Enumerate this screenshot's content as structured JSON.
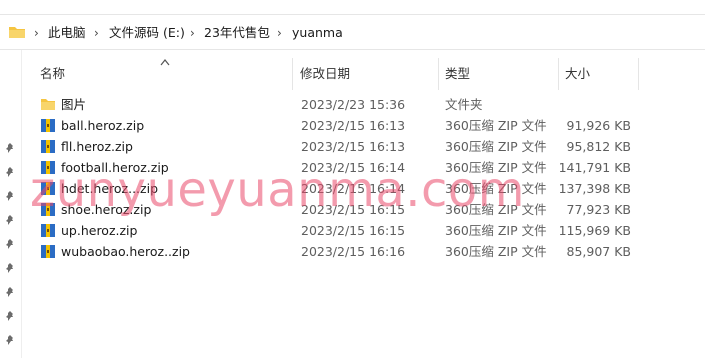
{
  "breadcrumb": {
    "items": [
      "此电脑",
      "文件源码 (E:)",
      "23年代售包",
      "yuanma"
    ],
    "separator": "›"
  },
  "header": {
    "name": "名称",
    "modified": "修改日期",
    "type": "类型",
    "size": "大小"
  },
  "files": [
    {
      "name": "图片",
      "modified": "2023/2/23 15:36",
      "type": "文件夹",
      "size": "",
      "icon": "folder-icon"
    },
    {
      "name": "ball.heroz.zip",
      "modified": "2023/2/15 16:13",
      "type": "360压缩 ZIP 文件",
      "size": "91,926 KB",
      "icon": "zip-archive-icon"
    },
    {
      "name": "fll.heroz.zip",
      "modified": "2023/2/15 16:13",
      "type": "360压缩 ZIP 文件",
      "size": "95,812 KB",
      "icon": "zip-archive-icon"
    },
    {
      "name": "football.heroz.zip",
      "modified": "2023/2/15 16:14",
      "type": "360压缩 ZIP 文件",
      "size": "141,791 KB",
      "icon": "zip-archive-icon"
    },
    {
      "name": "hdet.heroz...zip",
      "modified": "2023/2/15 16:14",
      "type": "360压缩 ZIP 文件",
      "size": "137,398 KB",
      "icon": "zip-archive-icon"
    },
    {
      "name": "shoe.heroz.zip",
      "modified": "2023/2/15 16:15",
      "type": "360压缩 ZIP 文件",
      "size": "77,923 KB",
      "icon": "zip-archive-icon"
    },
    {
      "name": "up.heroz.zip",
      "modified": "2023/2/15 16:15",
      "type": "360压缩 ZIP 文件",
      "size": "115,969 KB",
      "icon": "zip-archive-icon"
    },
    {
      "name": "wubaobao.heroz..zip",
      "modified": "2023/2/15 16:16",
      "type": "360压缩 ZIP 文件",
      "size": "85,907 KB",
      "icon": "zip-archive-icon"
    }
  ],
  "watermark": "zunyueyuanma.com",
  "colors": {
    "folder": "#f5c542",
    "zip_blue": "#2b6cc4",
    "zip_yellow": "#f3c300",
    "watermark": "#e94869"
  }
}
